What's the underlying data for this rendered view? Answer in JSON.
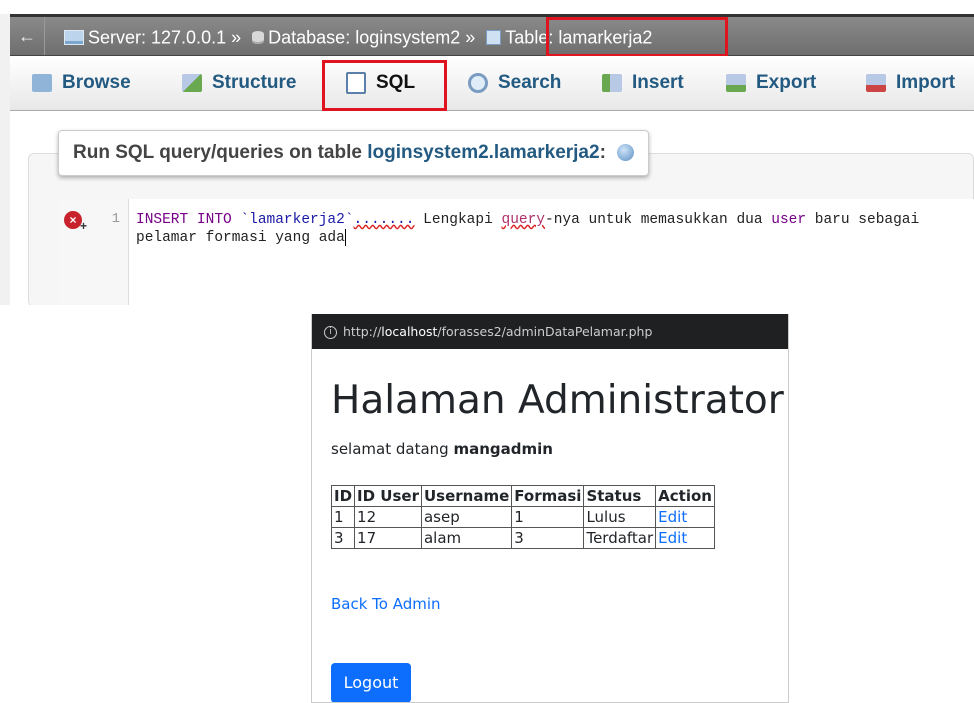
{
  "pma": {
    "back_arrow": "←",
    "breadcrumb": {
      "server": "Server: 127.0.0.1",
      "sep1": "»",
      "database": "Database: loginsystem2",
      "sep2": "»",
      "table": "Table: lamarkerja2"
    },
    "tabs": [
      {
        "label": "Browse",
        "icon": "browse-icon"
      },
      {
        "label": "Structure",
        "icon": "structure-icon"
      },
      {
        "label": "SQL",
        "icon": "sql-icon"
      },
      {
        "label": "Search",
        "icon": "search-icon"
      },
      {
        "label": "Insert",
        "icon": "insert-icon"
      },
      {
        "label": "Export",
        "icon": "export-icon"
      },
      {
        "label": "Import",
        "icon": "import-icon"
      }
    ],
    "legend": {
      "prefix": "Run SQL query/queries on table",
      "table_link": "loginsystem2.lamarkerja2",
      "suffix": ":"
    },
    "editor": {
      "line_number": "1",
      "tokens": {
        "insert_into": "INSERT INTO",
        "table": "`lamarkerja2`",
        "dots": ".......",
        "lengkapi": "Lengkapi",
        "query": "query",
        "rest1": "-nya untuk memasukkan dua",
        "user": "user",
        "rest2": "baru sebagai",
        "line2": "pelamar formasi yang ada"
      }
    },
    "highlight_color": "#e0141f"
  },
  "browser": {
    "url_prefix": "http://",
    "url_host": "localhost",
    "url_path": "/forasses2/adminDataPelamar.php",
    "title": "Halaman Administrator",
    "welcome_prefix": "selamat datang",
    "welcome_user": "mangadmin",
    "table": {
      "headers": [
        "ID",
        "ID User",
        "Username",
        "Formasi",
        "Status",
        "Action"
      ],
      "rows": [
        [
          "1",
          "12",
          "asep",
          "1",
          "Lulus",
          "Edit"
        ],
        [
          "3",
          "17",
          "alam",
          "3",
          "Terdaftar",
          "Edit"
        ]
      ]
    },
    "back_link": "Back To Admin",
    "logout_label": "Logout",
    "link_color": "#0d6efd"
  }
}
